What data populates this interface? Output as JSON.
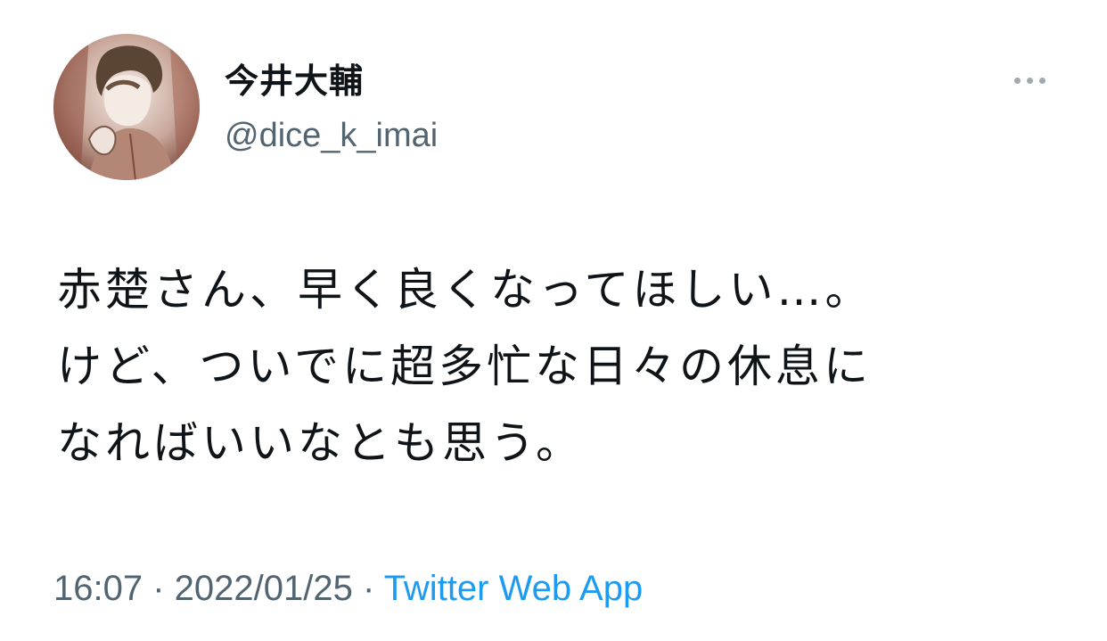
{
  "author": {
    "display_name": "今井大輔",
    "handle": "@dice_k_imai"
  },
  "tweet": {
    "lines": [
      "赤楚さん、早く良くなってほしい…。",
      "けど、ついでに超多忙な日々の休息に",
      "なればいいなとも思う。"
    ]
  },
  "meta": {
    "time": "16:07",
    "separator1": " · ",
    "date": "2022/01/25",
    "separator2": " · ",
    "source": "Twitter Web App"
  },
  "icons": {
    "more": "more-horizontal-icon"
  },
  "colors": {
    "text": "#0f1419",
    "secondary": "#536471",
    "link": "#1d9bf0"
  }
}
